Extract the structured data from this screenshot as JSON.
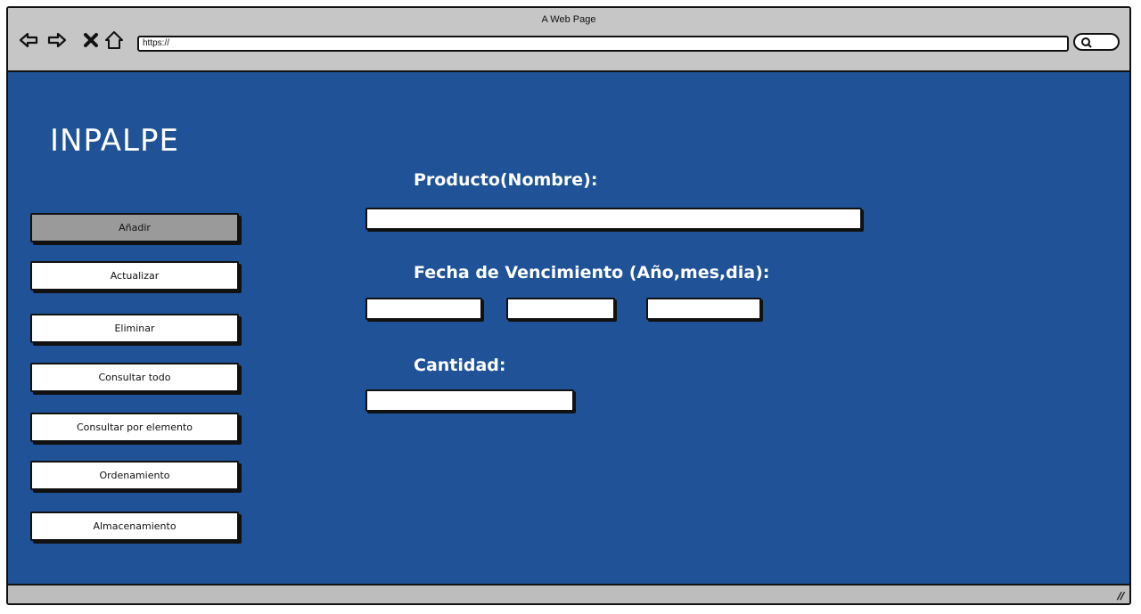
{
  "browser": {
    "window_title": "A Web Page",
    "url": "https://",
    "icons": [
      "back-arrow-icon",
      "forward-arrow-icon",
      "close-icon",
      "home-icon",
      "search-icon",
      "resize-grip-icon"
    ]
  },
  "app": {
    "brand": "INPALPE"
  },
  "sidebar": {
    "items": [
      {
        "label": "Añadir",
        "active": true
      },
      {
        "label": "Actualizar",
        "active": false
      },
      {
        "label": "Eliminar",
        "active": false
      },
      {
        "label": "Consultar todo",
        "active": false
      },
      {
        "label": "Consultar por elemento",
        "active": false
      },
      {
        "label": "Ordenamiento",
        "active": false
      },
      {
        "label": "Almacenamiento",
        "active": false
      }
    ]
  },
  "form": {
    "producto_label": "Producto(Nombre):",
    "producto_value": "",
    "fecha_label": "Fecha de Vencimiento (Año,mes,dia):",
    "fecha_anio_value": "",
    "fecha_mes_value": "",
    "fecha_dia_value": "",
    "cantidad_label": "Cantidad:",
    "cantidad_value": ""
  },
  "colors": {
    "content_bg": "#1f5297",
    "active_button": "#9a9a9a",
    "chrome": "#c6c6c6"
  }
}
